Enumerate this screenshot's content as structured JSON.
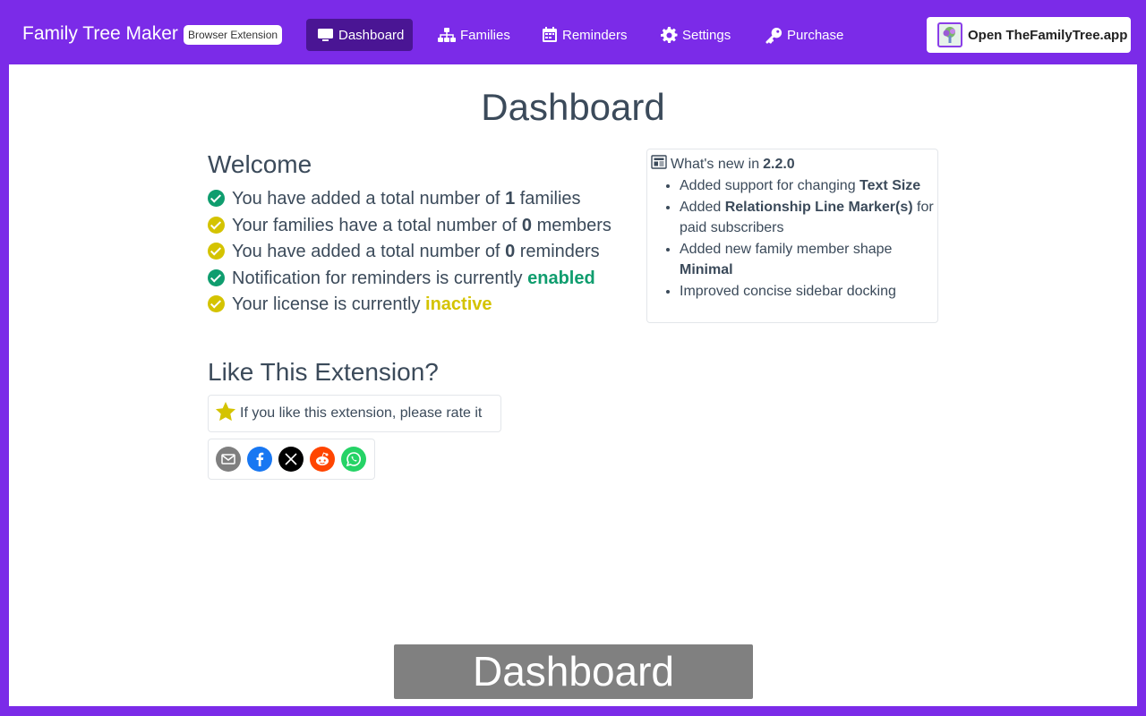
{
  "header": {
    "brand": "Family Tree Maker",
    "badge": "Browser Extension",
    "nav": [
      {
        "label": "Dashboard",
        "icon": "monitor-icon",
        "active": true
      },
      {
        "label": "Families",
        "icon": "sitemap-icon",
        "active": false
      },
      {
        "label": "Reminders",
        "icon": "calendar-icon",
        "active": false
      },
      {
        "label": "Settings",
        "icon": "gear-icon",
        "active": false
      },
      {
        "label": "Purchase",
        "icon": "key-icon",
        "active": false
      }
    ],
    "open_app_label": "Open TheFamilyTree.app"
  },
  "main": {
    "title": "Dashboard",
    "welcome": {
      "heading": "Welcome",
      "stats": [
        {
          "prefix": "You have added a total number of ",
          "value": "1",
          "suffix": " families",
          "status": "green"
        },
        {
          "prefix": "Your families have a total number of ",
          "value": "0",
          "suffix": " members",
          "status": "yellow"
        },
        {
          "prefix": "You have added a total number of ",
          "value": "0",
          "suffix": " reminders",
          "status": "yellow"
        },
        {
          "prefix": "Notification for reminders is currently ",
          "value": "enabled",
          "suffix": "",
          "status": "green"
        },
        {
          "prefix": "Your license is currently ",
          "value": "inactive",
          "suffix": "",
          "status": "yellow"
        }
      ]
    },
    "like": {
      "heading": "Like This Extension?",
      "rate_text": "If you like this extension, please rate it",
      "share": [
        "email-icon",
        "facebook-icon",
        "x-icon",
        "reddit-icon",
        "whatsapp-icon"
      ]
    },
    "news": {
      "prefix": "What's new in ",
      "version": "2.2.0",
      "items": [
        {
          "text": "Added support for changing ",
          "bold": "Text Size",
          "after": ""
        },
        {
          "text": "Added ",
          "bold": "Relationship Line Marker(s)",
          "after": " for paid subscribers"
        },
        {
          "text": "Added new family member shape ",
          "bold": "Minimal",
          "after": ""
        },
        {
          "text": "Improved concise sidebar docking",
          "bold": "",
          "after": ""
        }
      ]
    }
  },
  "caption": "Dashboard",
  "colors": {
    "brand_purple": "#7b2be8",
    "active_nav": "#4a1594",
    "status_green": "#0f9d6e",
    "status_yellow": "#d4c300"
  }
}
